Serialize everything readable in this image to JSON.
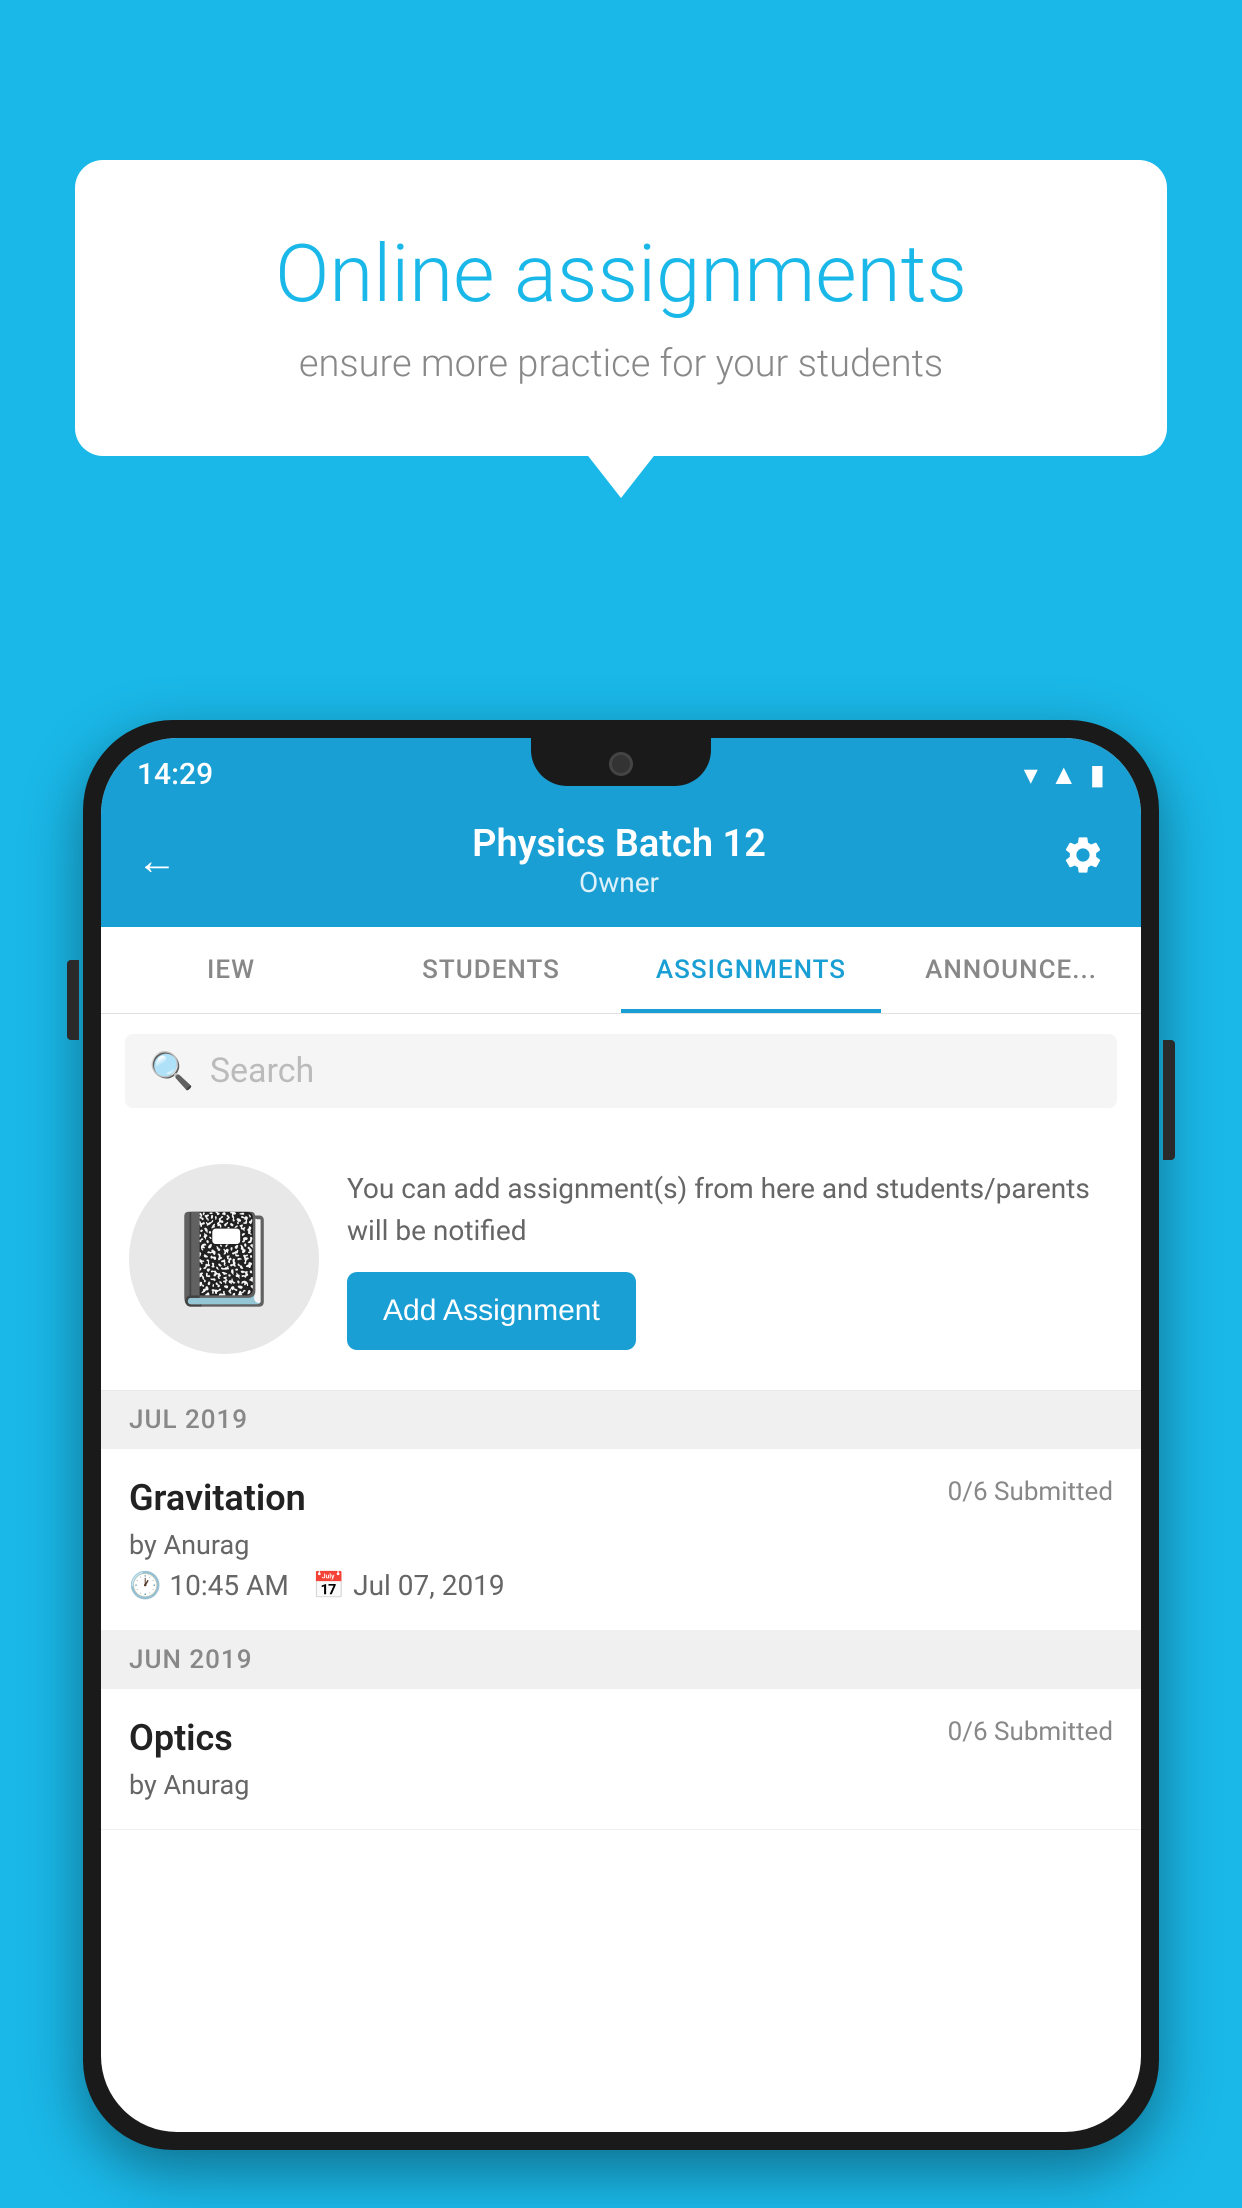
{
  "background_color": "#1ab8e8",
  "speech_bubble": {
    "title": "Online assignments",
    "subtitle": "ensure more practice for your students"
  },
  "phone": {
    "status_bar": {
      "time": "14:29"
    },
    "header": {
      "title": "Physics Batch 12",
      "subtitle": "Owner",
      "back_label": "←",
      "settings_label": "⚙"
    },
    "tabs": [
      {
        "label": "IEW",
        "active": false
      },
      {
        "label": "STUDENTS",
        "active": false
      },
      {
        "label": "ASSIGNMENTS",
        "active": true
      },
      {
        "label": "ANNOUNCEMENTS",
        "active": false
      }
    ],
    "search": {
      "placeholder": "Search"
    },
    "promo": {
      "text": "You can add assignment(s) from here and students/parents will be notified",
      "button_label": "Add Assignment"
    },
    "sections": [
      {
        "month_label": "JUL 2019",
        "assignments": [
          {
            "name": "Gravitation",
            "submitted": "0/6 Submitted",
            "by": "by Anurag",
            "time": "10:45 AM",
            "date": "Jul 07, 2019"
          }
        ]
      },
      {
        "month_label": "JUN 2019",
        "assignments": [
          {
            "name": "Optics",
            "submitted": "0/6 Submitted",
            "by": "by Anurag",
            "time": "",
            "date": ""
          }
        ]
      }
    ]
  }
}
